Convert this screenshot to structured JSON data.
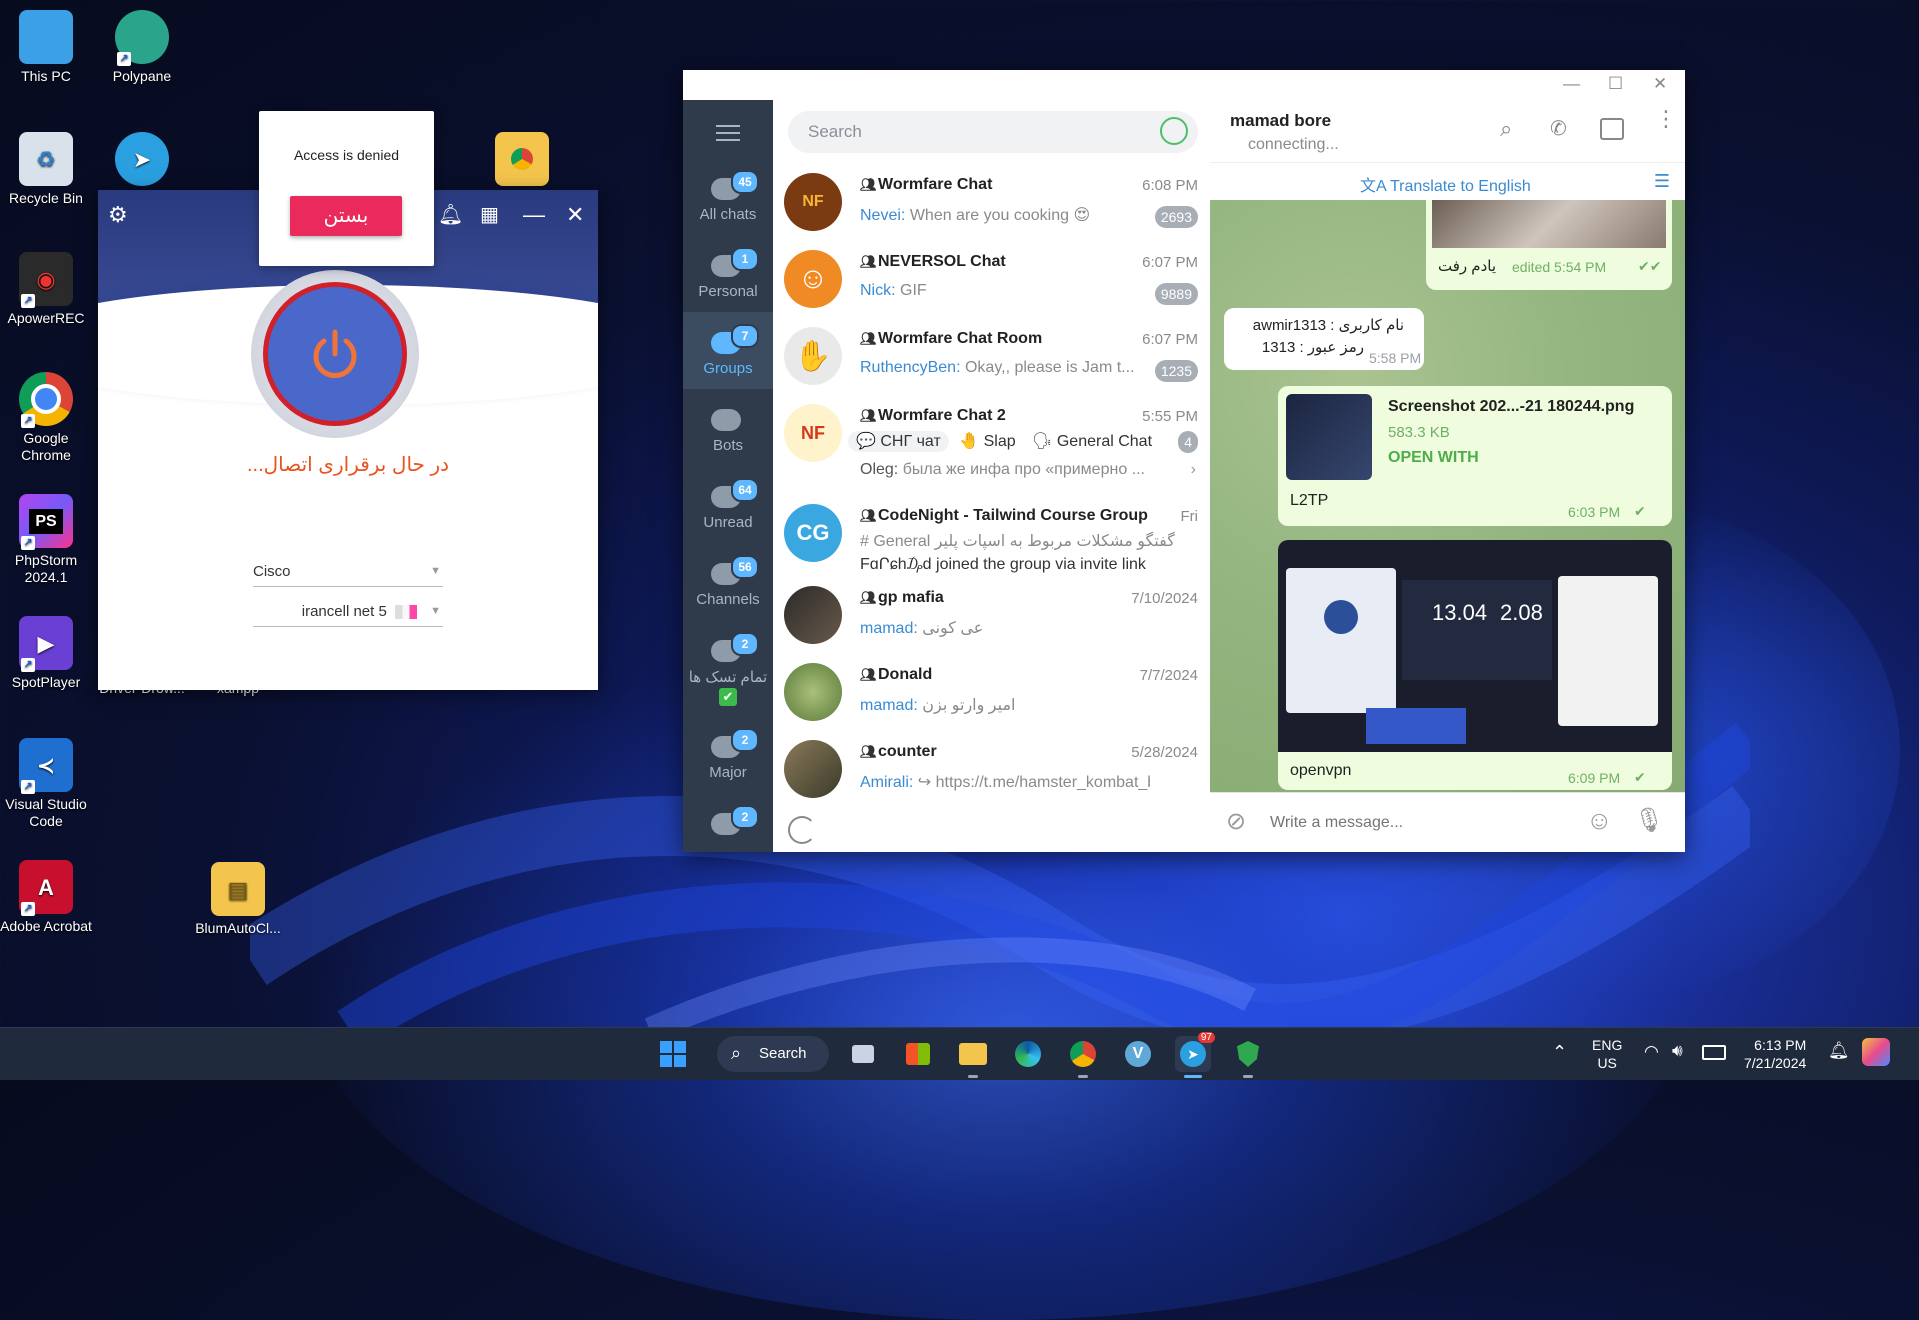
{
  "desktop": {
    "icons": [
      {
        "label": "This PC",
        "color": "#3ba0e6",
        "glyph": "▭"
      },
      {
        "label": "Polypane",
        "color": "#2aa58c",
        "glyph": "◐"
      },
      {
        "label": "Recycle Bin",
        "color": "#d9e2ea",
        "glyph": "♻"
      },
      {
        "label": "ApowerREC",
        "color": "#2a2a2a",
        "glyph": "◉"
      },
      {
        "label": "Google Chrome",
        "color": "#ffffff",
        "glyph": "◎"
      },
      {
        "label": "PhpStorm 2024.1",
        "color": "#6b2bd9",
        "glyph": "PS"
      },
      {
        "label": "SpotPlayer",
        "color": "#6a3fd4",
        "glyph": "▶"
      },
      {
        "label": "Visual Studio Code",
        "color": "#1f6fd0",
        "glyph": "≺"
      },
      {
        "label": "Adobe Acrobat",
        "color": "#c8102e",
        "glyph": "A"
      },
      {
        "label": "BlumAutoCl...",
        "color": "#f3c54c",
        "glyph": "▤"
      },
      {
        "label": "Driver-Drow...",
        "color": "#4a74c9",
        "glyph": ""
      },
      {
        "label": "xampp",
        "color": "#f08a24",
        "glyph": ""
      }
    ]
  },
  "vpn": {
    "status_text": "در حال برقراری اتصال...",
    "protocol": "Cisco",
    "server": "irancell net 5",
    "dialog_message": "Access is denied",
    "dialog_button": "بستن"
  },
  "telegram": {
    "search_placeholder": "Search",
    "folders": [
      {
        "label": "All chats",
        "count": "45"
      },
      {
        "label": "Personal",
        "count": "1"
      },
      {
        "label": "Groups",
        "count": "7"
      },
      {
        "label": "Bots",
        "count": ""
      },
      {
        "label": "Unread",
        "count": "64"
      },
      {
        "label": "Channels",
        "count": "56"
      },
      {
        "label": "تمام تسک ها",
        "count": "2"
      },
      {
        "label": "Major",
        "count": "2"
      },
      {
        "label": "",
        "count": "2"
      }
    ],
    "chats": [
      {
        "name": "Wormfare Chat",
        "time": "6:08 PM",
        "who": "Nevei:",
        "text": "When are you cooking 😍",
        "badge": "2693",
        "avatar": "NF",
        "avatar_color": "#7a3a12"
      },
      {
        "name": "NEVERSOL Chat",
        "time": "6:07 PM",
        "who": "Nick:",
        "text": "GIF",
        "badge": "9889",
        "avatar": "☺",
        "avatar_color": "#f08a24"
      },
      {
        "name": "Wormfare Chat Room",
        "time": "6:07 PM",
        "who": "RuthencyBen:",
        "text": "Okay,, please is Jam t...",
        "badge": "1235",
        "avatar": "✋",
        "avatar_color": "#e0e0e0"
      },
      {
        "name": "Wormfare Chat 2",
        "time": "5:55 PM",
        "who": "Oleg:",
        "text": "была же инфа про «примерно ...",
        "badge": "4",
        "avatar": "NF",
        "avatar_color": "#fff3cc"
      },
      {
        "name": "CodeNight - Tailwind Course Group",
        "time": "Fri",
        "who": "",
        "text": "FɑՐɕh₯d joined the group via invite link",
        "badge": "",
        "avatar": "CG",
        "avatar_color": "#3aa7e0"
      },
      {
        "name": "gp mafia",
        "time": "7/10/2024",
        "who": "mamad:",
        "text": "عی کونی",
        "badge": "",
        "avatar": "",
        "avatar_color": "#5a4a3a"
      },
      {
        "name": "Donald",
        "time": "7/7/2024",
        "who": "mamad:",
        "text": "امیر وارتو بزن",
        "badge": "",
        "avatar": "",
        "avatar_color": "#7a9a5a"
      },
      {
        "name": "counter",
        "time": "5/28/2024",
        "who": "Amirali:",
        "text": "↪ https://t.me/hamster_kombat_b...",
        "badge": "",
        "avatar": "",
        "avatar_color": "#6a6a5a"
      }
    ],
    "chat4_topics": [
      "💬 СНГ чат",
      "🤚 Slap",
      "🗣 General Chat"
    ],
    "chat5_topic_line": "# General  گفتگو  مشکلات مربوط به اسپات پلیر",
    "header": {
      "title": "mamad bore",
      "status": "connecting..."
    },
    "translate_label": "Translate to English",
    "messages": {
      "m1_text": "یادم رفت",
      "m1_meta": "edited 5:54 PM",
      "m2_line1": "نام کاربری : awmir1313",
      "m2_line2": "رمز عبور : 1313",
      "m2_time": "5:58 PM",
      "file_name": "Screenshot 202...-21 180244.png",
      "file_size": "583.3 KB",
      "file_action": "OPEN WITH",
      "file_caption": "L2TP",
      "file_time": "6:03 PM",
      "img_caption": "openvpn",
      "img_time": "6:09 PM"
    },
    "composer_placeholder": "Write a message..."
  },
  "taskbar": {
    "search_label": "Search",
    "telegram_badge": "97",
    "lang_top": "ENG",
    "lang_bottom": "US",
    "clock_time": "6:13 PM",
    "clock_date": "7/21/2024"
  }
}
